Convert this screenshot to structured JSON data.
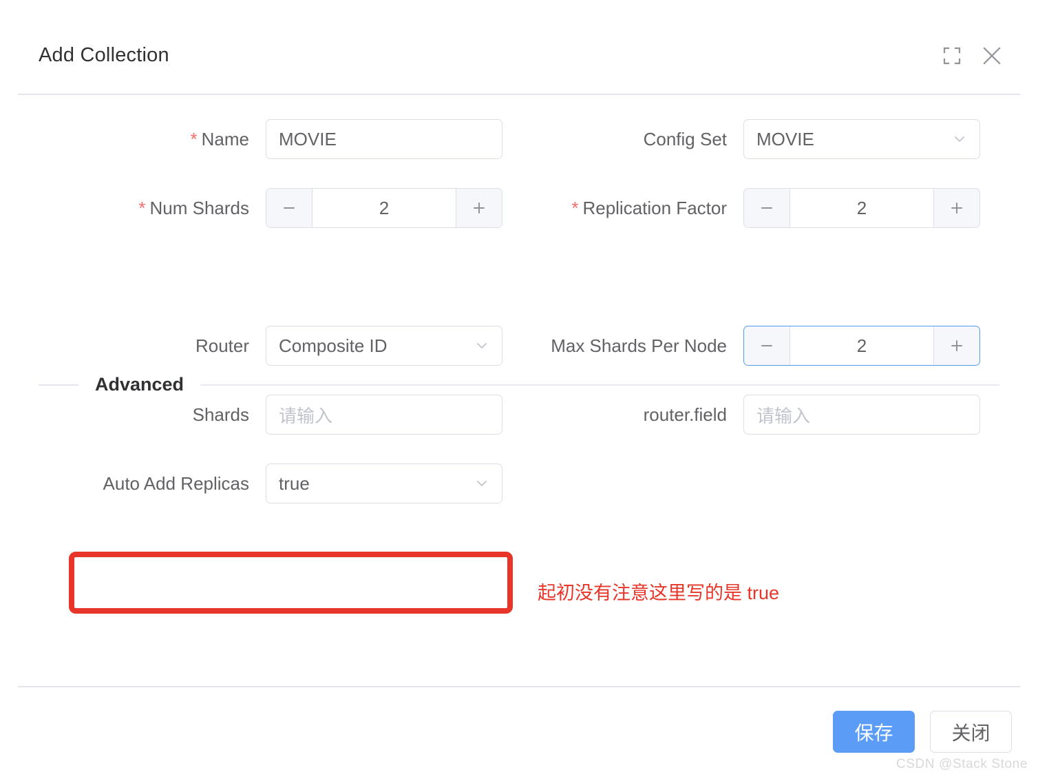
{
  "dialog": {
    "title": "Add Collection",
    "header_icons": {
      "fullscreen": "fullscreen-icon",
      "close": "close-icon"
    }
  },
  "form": {
    "name": {
      "label": "Name",
      "required_mark": "*",
      "value": "MOVIE"
    },
    "config_set": {
      "label": "Config Set",
      "value": "MOVIE"
    },
    "num_shards": {
      "label": "Num Shards",
      "required_mark": "*",
      "value": "2",
      "minus": "—",
      "plus": "+"
    },
    "replication_factor": {
      "label": "Replication Factor",
      "required_mark": "*",
      "value": "2",
      "minus": "—",
      "plus": "+"
    }
  },
  "advanced": {
    "title": "Advanced",
    "router": {
      "label": "Router",
      "value": "Composite ID"
    },
    "max_shards_per_node": {
      "label": "Max Shards Per Node",
      "value": "2",
      "minus": "—",
      "plus": "+",
      "focused": true
    },
    "shards": {
      "label": "Shards",
      "value": "",
      "placeholder": "请输入"
    },
    "router_field": {
      "label": "router.field",
      "value": "",
      "placeholder": "请输入"
    },
    "auto_add_replicas": {
      "label": "Auto Add Replicas",
      "value": "true"
    }
  },
  "annotation": {
    "text": "起初没有注意这里写的是 true",
    "color": "#e8352a"
  },
  "footer": {
    "save_label": "保存",
    "close_label": "关闭"
  },
  "watermark": "CSDN @Stack Stone",
  "colors": {
    "primary_blue": "#5a9cf6",
    "focus_blue": "#509bf5",
    "required_red": "#f56c6c",
    "annotation_red": "#e8352a",
    "border_gray": "#dcdfe6",
    "text_gray": "#606266"
  }
}
